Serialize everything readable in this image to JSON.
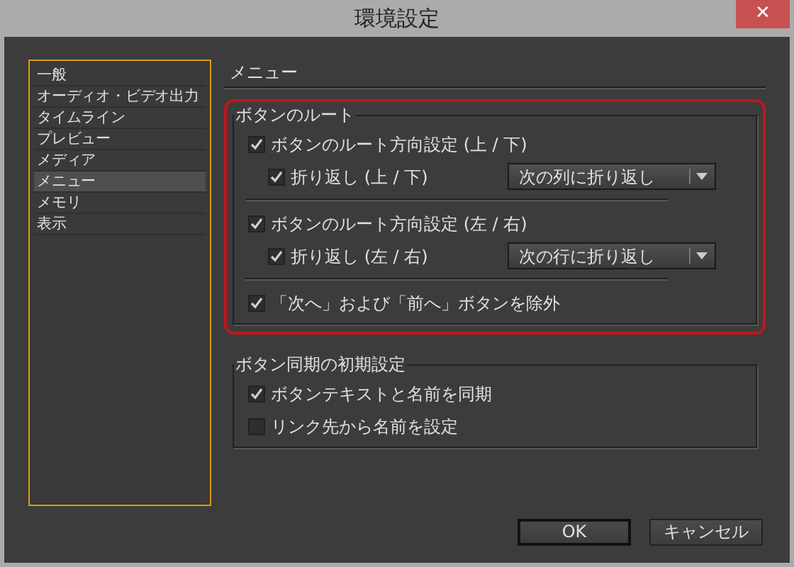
{
  "window": {
    "title": "環境設定",
    "close": "✕"
  },
  "sidebar": {
    "items": [
      {
        "label": "一般",
        "selected": false
      },
      {
        "label": "オーディオ・ビデオ出力",
        "selected": false
      },
      {
        "label": "タイムライン",
        "selected": false
      },
      {
        "label": "プレビュー",
        "selected": false
      },
      {
        "label": "メディア",
        "selected": false
      },
      {
        "label": "メニュー",
        "selected": true
      },
      {
        "label": "メモリ",
        "selected": false
      },
      {
        "label": "表示",
        "selected": false
      }
    ]
  },
  "panel": {
    "heading": "メニュー",
    "groups": [
      {
        "title": "ボタンのルート",
        "highlighted": true,
        "separators": true,
        "options": [
          {
            "label": "ボタンのルート方向設定 (上 / 下)",
            "checked": true,
            "children": [
              {
                "label": "折り返し (上 / 下)",
                "checked": true,
                "dropdown": "次の列に折り返し"
              }
            ]
          },
          {
            "label": "ボタンのルート方向設定 (左 / 右)",
            "checked": true,
            "children": [
              {
                "label": "折り返し (左 / 右)",
                "checked": true,
                "dropdown": "次の行に折り返し"
              }
            ]
          },
          {
            "label": "「次へ」および「前へ」ボタンを除外",
            "checked": true
          }
        ]
      },
      {
        "title": "ボタン同期の初期設定",
        "highlighted": false,
        "separators": false,
        "options": [
          {
            "label": "ボタンテキストと名前を同期",
            "checked": true
          },
          {
            "label": "リンク先から名前を設定",
            "checked": false
          }
        ]
      }
    ]
  },
  "buttons": [
    {
      "label": "OK",
      "default": true
    },
    {
      "label": "キャンセル",
      "default": false
    }
  ]
}
